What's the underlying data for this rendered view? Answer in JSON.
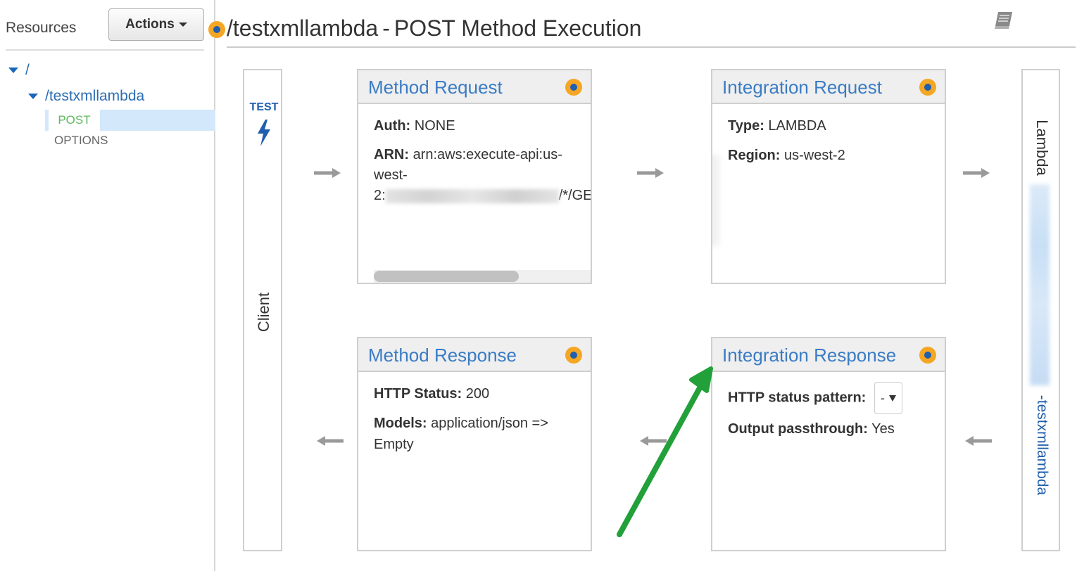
{
  "sidebar": {
    "title": "Resources",
    "actions_label": "Actions",
    "tree": {
      "root": "/",
      "resource": "/testxmllambda",
      "methods": [
        "POST",
        "OPTIONS"
      ]
    }
  },
  "header": {
    "resource_path": "/testxmllambda",
    "separator": "-",
    "method": "POST",
    "title_suffix": "Method Execution"
  },
  "client": {
    "test_label": "TEST",
    "label": "Client"
  },
  "lambda": {
    "label": "Lambda",
    "function_suffix": "-testxmllambda"
  },
  "method_request": {
    "title": "Method Request",
    "auth_label": "Auth:",
    "auth_value": "NONE",
    "arn_label": "ARN:",
    "arn_value_line1": "arn:aws:execute-api:us-",
    "arn_value_line2": "west-",
    "arn_prefix": "2:",
    "arn_suffix": "/*/GE"
  },
  "integration_request": {
    "title": "Integration Request",
    "type_label": "Type:",
    "type_value": "LAMBDA",
    "region_label": "Region:",
    "region_value": "us-west-2"
  },
  "method_response": {
    "title": "Method Response",
    "status_label": "HTTP Status:",
    "status_value": "200",
    "models_label": "Models:",
    "models_value": "application/json =>",
    "models_value2": "Empty"
  },
  "integration_response": {
    "title": "Integration Response",
    "pattern_label": "HTTP status pattern:",
    "pattern_value": "-",
    "passthrough_label": "Output passthrough:",
    "passthrough_value": "Yes"
  },
  "colors": {
    "accent_blue": "#3a7cc4",
    "link_blue": "#1f5fae",
    "orange_dot": "#f5a623",
    "post_green": "#5cb85c",
    "annotation_green": "#22a03a",
    "selection_bg": "#d3e8fb"
  },
  "icons": {
    "header": "book-icon",
    "test": "lightning-bolt-icon",
    "card_status": "orange-dot-icon"
  }
}
